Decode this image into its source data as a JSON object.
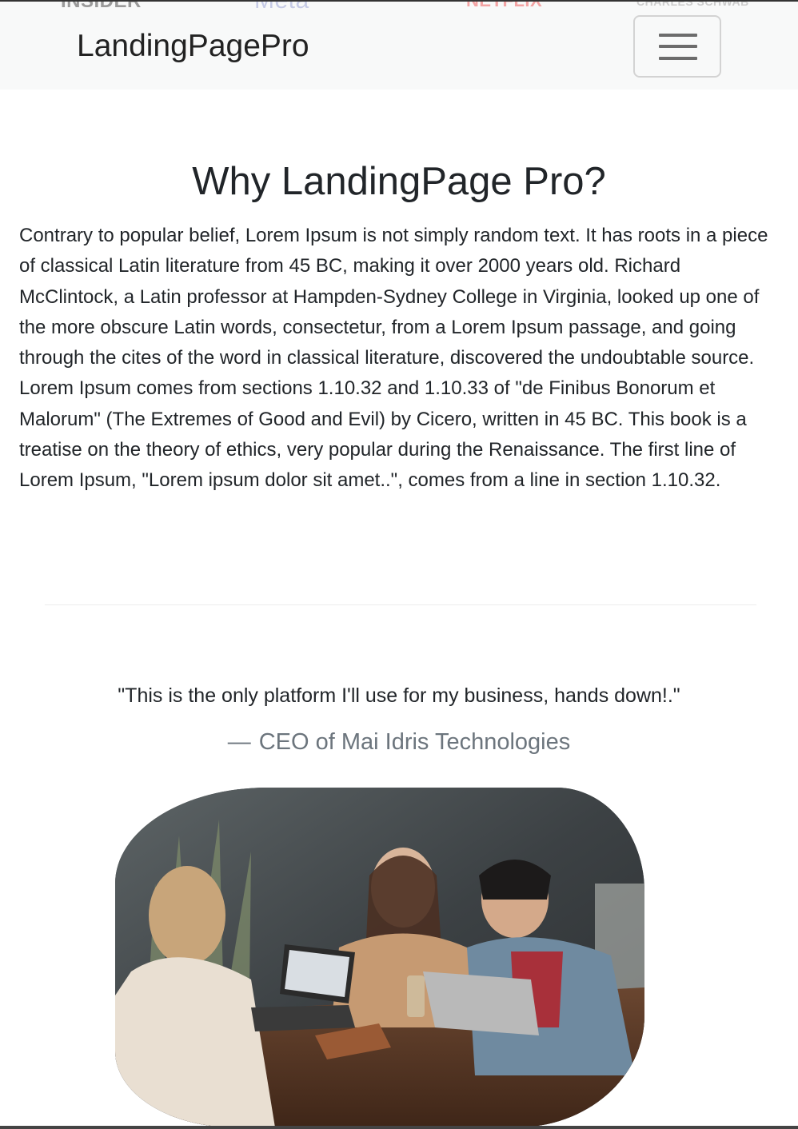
{
  "partner_logos": [
    "INSIDER",
    "Meta",
    "NETFLIX",
    "CHARLES SCHWAB"
  ],
  "navbar": {
    "brand": "LandingPagePro",
    "toggler_icon": "hamburger-menu-icon"
  },
  "why_section": {
    "title": "Why LandingPage Pro?",
    "body": "Contrary to popular belief, Lorem Ipsum is not simply random text. It has roots in a piece of classical Latin literature from 45 BC, making it over 2000 years old. Richard McClintock, a Latin professor at Hampden-Sydney College in Virginia, looked up one of the more obscure Latin words, consectetur, from a Lorem Ipsum passage, and going through the cites of the word in classical literature, discovered the undoubtable source. Lorem Ipsum comes from sections 1.10.32 and 1.10.33 of \"de Finibus Bonorum et Malorum\" (The Extremes of Good and Evil) by Cicero, written in 45 BC. This book is a treatise on the theory of ethics, very popular during the Renaissance. The first line of Lorem Ipsum, \"Lorem ipsum dolor sit amet..\", comes from a line in section 1.10.32."
  },
  "testimonial": {
    "quote": "\"This is the only platform I'll use for my business, hands down!.\"",
    "dash": "—",
    "author": "CEO of Mai Idris Technologies"
  },
  "colors": {
    "navbar_bg": "#f8f9f9",
    "text": "#212529",
    "muted": "#6c757d"
  }
}
